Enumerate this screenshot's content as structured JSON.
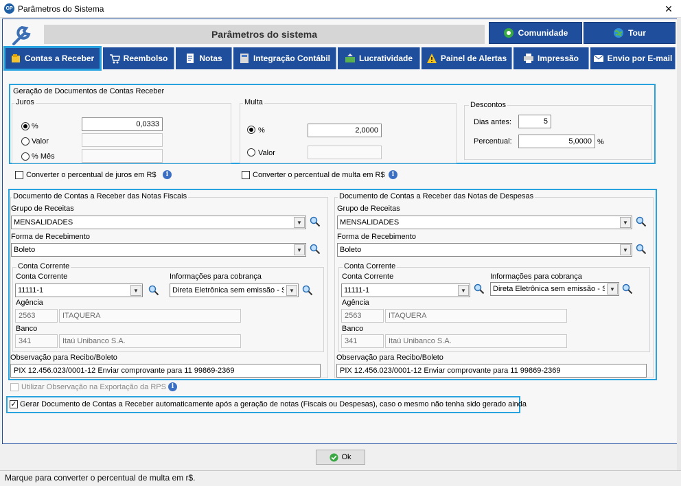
{
  "window": {
    "title": "Parâmetros do Sistema",
    "app_icon": "GP"
  },
  "header": {
    "title": "Parâmetros do sistema",
    "community_label": "Comunidade",
    "tour_label": "Tour"
  },
  "tabs": [
    {
      "label": "Contas a Receber",
      "active": true
    },
    {
      "label": "Reembolso"
    },
    {
      "label": "Notas"
    },
    {
      "label": "Integração Contábil"
    },
    {
      "label": "Lucratividade"
    },
    {
      "label": "Painel de Alertas"
    },
    {
      "label": "Impressão"
    },
    {
      "label": "Envio por E-mail"
    }
  ],
  "geracao": {
    "title": "Geração de Documentos de Contas Receber",
    "juros": {
      "title": "Juros",
      "opt_percent": "%",
      "opt_valor": "Valor",
      "opt_percent_mes": "% Mês",
      "percent_value": "0,0333",
      "converter_label": "Converter o percentual de juros em R$"
    },
    "multa": {
      "title": "Multa",
      "opt_percent": "%",
      "opt_valor": "Valor",
      "percent_value": "2,0000",
      "converter_label": "Converter o percentual de multa em R$"
    },
    "descontos": {
      "title": "Descontos",
      "dias_label": "Dias antes:",
      "dias_value": "5",
      "percentual_label": "Percentual:",
      "percentual_value": "5,0000",
      "percent_sign": "%"
    }
  },
  "fiscais": {
    "title": "Documento de Contas a Receber das Notas Fiscais",
    "grupo_label": "Grupo de Receitas",
    "grupo_value": "MENSALIDADES",
    "forma_label": "Forma de Recebimento",
    "forma_value": "Boleto",
    "conta_group_title": "Conta Corrente",
    "conta_label": "Conta Corrente",
    "conta_value": "11111-1",
    "info_cobranca_label": "Informações para cobrança",
    "info_cobranca_value": "Direta Eletrônica sem emissão - Sin",
    "agencia_label": "Agência",
    "agencia_code": "2563",
    "agencia_name": "ITAQUERA",
    "banco_label": "Banco",
    "banco_code": "341",
    "banco_name": "Itaú Unibanco S.A.",
    "obs_label": "Observação para Recibo/Boleto",
    "obs_value": "PIX 12.456.023/0001-12 Enviar comprovante para 11 99869-2369"
  },
  "despesas": {
    "title": "Documento de Contas a Receber das Notas de Despesas",
    "grupo_label": "Grupo de Receitas",
    "grupo_value": "MENSALIDADES",
    "forma_label": "Forma de Recebimento",
    "forma_value": "Boleto",
    "conta_group_title": "Conta Corrente",
    "conta_label": "Conta Corrente",
    "conta_value": "11111-1",
    "info_cobranca_label": "Informações para cobrança",
    "info_cobranca_value": "Direta Eletrônica sem emissão - Sin",
    "agencia_label": "Agência",
    "agencia_code": "2563",
    "agencia_name": "ITAQUERA",
    "banco_label": "Banco",
    "banco_code": "341",
    "banco_name": "Itaú Unibanco S.A.",
    "obs_label": "Observação para Recibo/Boleto",
    "obs_value": "PIX 12.456.023/0001-12 Enviar comprovante para 11 99869-2369"
  },
  "utilizar_obs_label": "Utilizar Observação na Exportação da RPS",
  "gerar_label": "Gerar Documento de Contas a Receber automaticamente após a geração de notas (Fiscais ou Despesas), caso o mesmo não tenha sido gerado ainda",
  "ok_label": "Ok",
  "status_text": "Marque para converter o percentual de multa em r$.",
  "colors": {
    "tab_blue": "#1f4e9c",
    "highlight": "#29a3e0"
  }
}
